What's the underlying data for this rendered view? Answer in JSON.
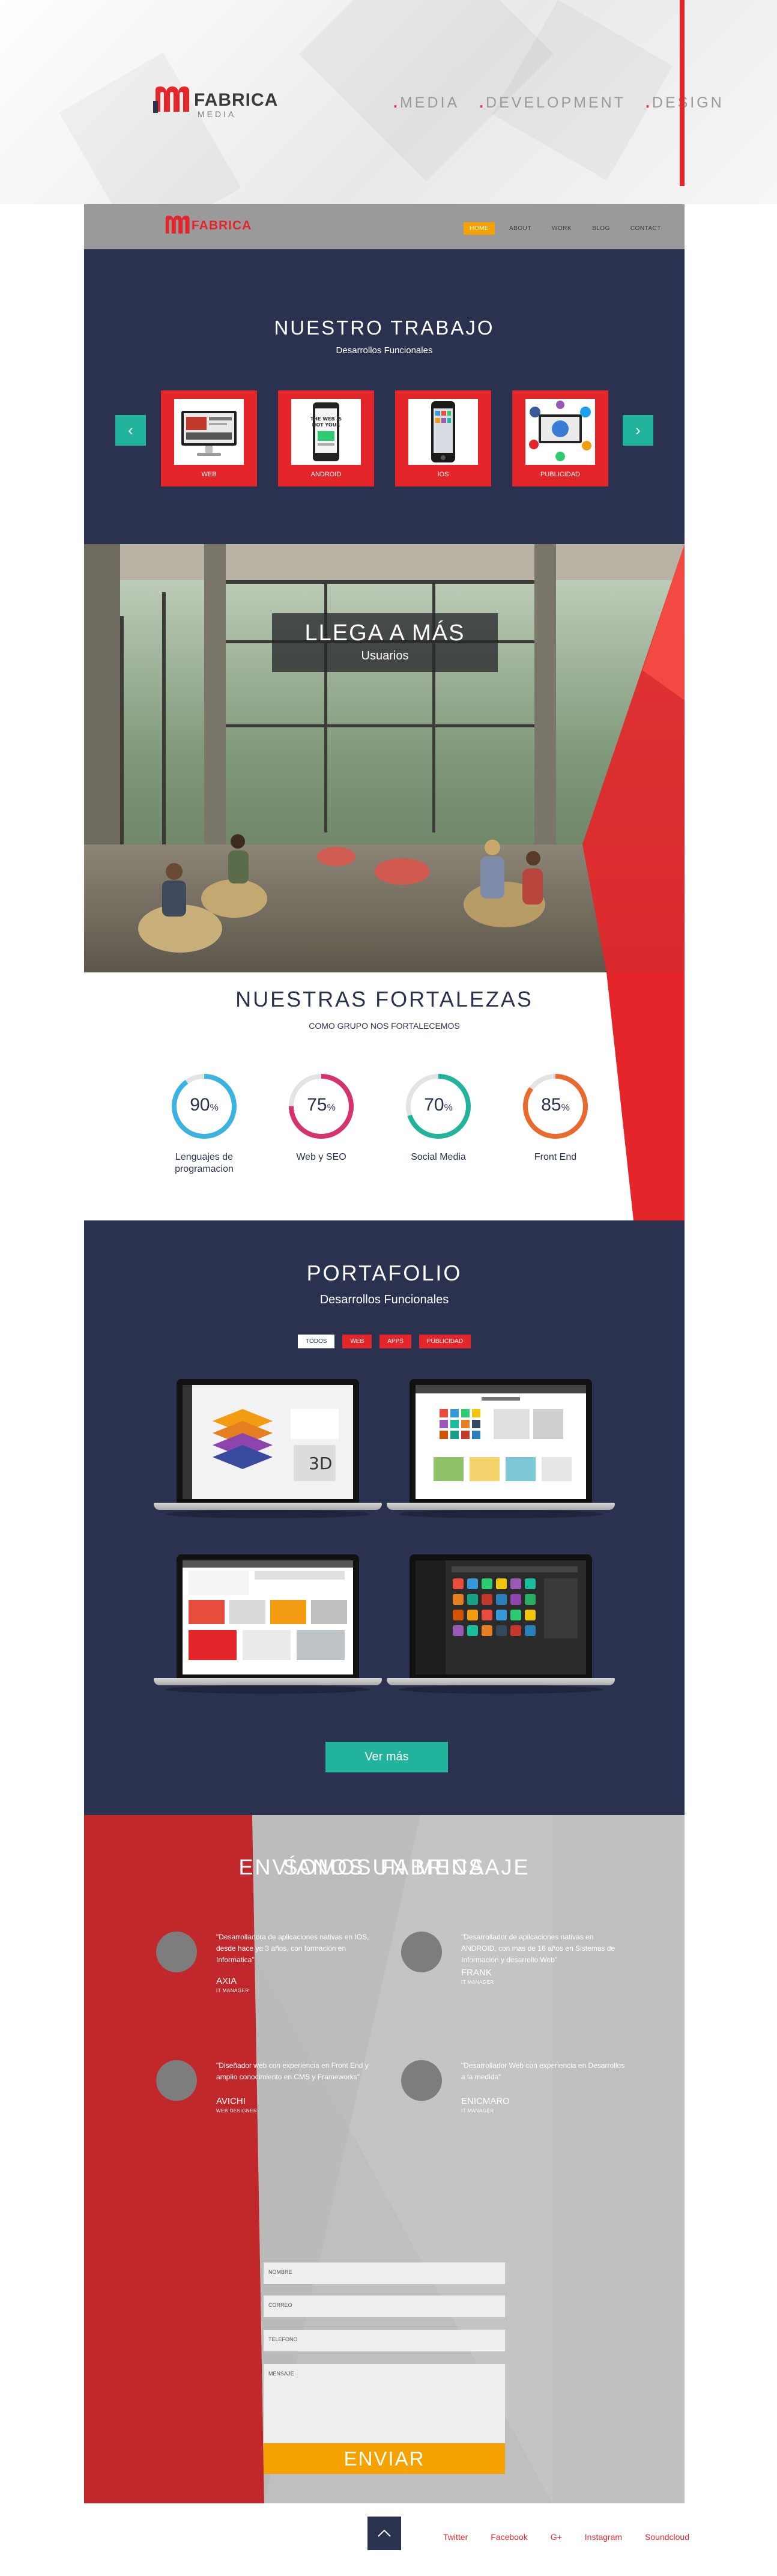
{
  "brand": {
    "name": "FABRICA",
    "sub": "MEDIA",
    "taglines": [
      "MEDIA",
      "DEVELOPMENT",
      "DESIGN"
    ],
    "colors": {
      "red": "#e4262a",
      "navy": "#2a3250",
      "teal": "#22b39c",
      "orange": "#f5a200",
      "gray": "#9a9a9a"
    }
  },
  "nav": {
    "items": [
      {
        "label": "HOME",
        "active": true
      },
      {
        "label": "ABOUT"
      },
      {
        "label": "WORK"
      },
      {
        "label": "BLOG"
      },
      {
        "label": "CONTACT"
      }
    ]
  },
  "trabajo": {
    "title": "NUESTRO TRABAJO",
    "subtitle": "Desarrollos Funcionales",
    "prev_icon": "chevron-left-icon",
    "next_icon": "chevron-right-icon",
    "cards": [
      {
        "label": "WEB",
        "icon": "desktop-monitor-icon"
      },
      {
        "label": "ANDROID",
        "icon": "android-phone-icon"
      },
      {
        "label": "IOS",
        "icon": "iphone-icon"
      },
      {
        "label": "PUBLICIDAD",
        "icon": "social-network-globe-icon"
      }
    ]
  },
  "hero": {
    "title": "LLEGA A MÁS",
    "subtitle": "Usuarios"
  },
  "fortalezas": {
    "title": "NUESTRAS FORTALEZAS",
    "subtitle": "COMO GRUPO NOS FORTALECEMOS",
    "stats": [
      {
        "value": 90,
        "unit": "%",
        "label": "Lenguajes de programacion",
        "color": "#3ab3e0"
      },
      {
        "value": 75,
        "unit": "%",
        "label": "Web y SEO",
        "color": "#d6336c"
      },
      {
        "value": 70,
        "unit": "%",
        "label": "Social Media",
        "color": "#22b39c"
      },
      {
        "value": 85,
        "unit": "%",
        "label": "Front End",
        "color": "#ea6a2e"
      }
    ]
  },
  "portafolio": {
    "title": "PORTAFOLIO",
    "subtitle": "Desarrollos Funcionales",
    "filters": [
      {
        "label": "TODOS",
        "active": true
      },
      {
        "label": "WEB"
      },
      {
        "label": "APPS"
      },
      {
        "label": "PUBLICIDAD"
      }
    ],
    "more_label": "Ver más"
  },
  "somos": {
    "title": "SOMOS FABRICA",
    "members": [
      {
        "quote": "\"Desarrolladora de aplicaciones nativas en IOS, desde hace ya 3 años, con formación en Informatica\"",
        "name": "AXIA",
        "role": "IT MANAGER"
      },
      {
        "quote": "\"Desarrollador de aplicaciones nativas en ANDROID, con mas de 16 años en Sistemas de Información y desarrollo Web\"",
        "name": "FRANK",
        "role": "IT MANAGER"
      },
      {
        "quote": "\"Diseñador web con experiencia en Front End y amplio conocimiento en CMS y Frameworks\"",
        "name": "AVICHI",
        "role": "WEB DESIGNER"
      },
      {
        "quote": "\"Desarrollador Web con experiencia en Desarrollos a la medida\"",
        "name": "ENICMARO",
        "role": "IT MANAGER"
      }
    ]
  },
  "contact": {
    "title": "ENVÍANOS UN MENSAJE",
    "fields": [
      "NOMBRE",
      "CORREO",
      "TELEFONO",
      "MENSAJE"
    ],
    "submit": "ENVIAR"
  },
  "footer": {
    "up_icon": "arrow-up-icon",
    "social": [
      "Twitter",
      "Facebook",
      "G+",
      "Instagram",
      "Soundcloud"
    ]
  }
}
